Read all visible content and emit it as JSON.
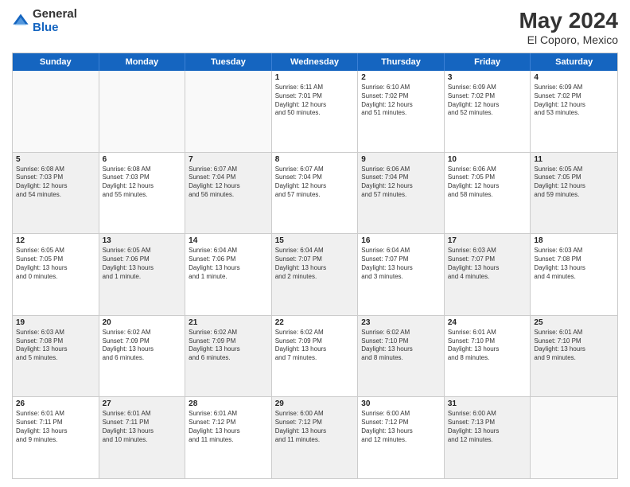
{
  "header": {
    "logo_general": "General",
    "logo_blue": "Blue",
    "title": "May 2024",
    "subtitle": "El Coporo, Mexico"
  },
  "weekdays": [
    "Sunday",
    "Monday",
    "Tuesday",
    "Wednesday",
    "Thursday",
    "Friday",
    "Saturday"
  ],
  "rows": [
    {
      "shade": [
        false,
        false,
        false,
        false,
        false,
        false,
        false
      ],
      "cells": [
        {
          "day": "",
          "lines": []
        },
        {
          "day": "",
          "lines": []
        },
        {
          "day": "",
          "lines": []
        },
        {
          "day": "1",
          "lines": [
            "Sunrise: 6:11 AM",
            "Sunset: 7:01 PM",
            "Daylight: 12 hours",
            "and 50 minutes."
          ]
        },
        {
          "day": "2",
          "lines": [
            "Sunrise: 6:10 AM",
            "Sunset: 7:02 PM",
            "Daylight: 12 hours",
            "and 51 minutes."
          ]
        },
        {
          "day": "3",
          "lines": [
            "Sunrise: 6:09 AM",
            "Sunset: 7:02 PM",
            "Daylight: 12 hours",
            "and 52 minutes."
          ]
        },
        {
          "day": "4",
          "lines": [
            "Sunrise: 6:09 AM",
            "Sunset: 7:02 PM",
            "Daylight: 12 hours",
            "and 53 minutes."
          ]
        }
      ]
    },
    {
      "shade": [
        true,
        false,
        true,
        false,
        true,
        false,
        true
      ],
      "cells": [
        {
          "day": "5",
          "lines": [
            "Sunrise: 6:08 AM",
            "Sunset: 7:03 PM",
            "Daylight: 12 hours",
            "and 54 minutes."
          ]
        },
        {
          "day": "6",
          "lines": [
            "Sunrise: 6:08 AM",
            "Sunset: 7:03 PM",
            "Daylight: 12 hours",
            "and 55 minutes."
          ]
        },
        {
          "day": "7",
          "lines": [
            "Sunrise: 6:07 AM",
            "Sunset: 7:04 PM",
            "Daylight: 12 hours",
            "and 56 minutes."
          ]
        },
        {
          "day": "8",
          "lines": [
            "Sunrise: 6:07 AM",
            "Sunset: 7:04 PM",
            "Daylight: 12 hours",
            "and 57 minutes."
          ]
        },
        {
          "day": "9",
          "lines": [
            "Sunrise: 6:06 AM",
            "Sunset: 7:04 PM",
            "Daylight: 12 hours",
            "and 57 minutes."
          ]
        },
        {
          "day": "10",
          "lines": [
            "Sunrise: 6:06 AM",
            "Sunset: 7:05 PM",
            "Daylight: 12 hours",
            "and 58 minutes."
          ]
        },
        {
          "day": "11",
          "lines": [
            "Sunrise: 6:05 AM",
            "Sunset: 7:05 PM",
            "Daylight: 12 hours",
            "and 59 minutes."
          ]
        }
      ]
    },
    {
      "shade": [
        false,
        true,
        false,
        true,
        false,
        true,
        false
      ],
      "cells": [
        {
          "day": "12",
          "lines": [
            "Sunrise: 6:05 AM",
            "Sunset: 7:05 PM",
            "Daylight: 13 hours",
            "and 0 minutes."
          ]
        },
        {
          "day": "13",
          "lines": [
            "Sunrise: 6:05 AM",
            "Sunset: 7:06 PM",
            "Daylight: 13 hours",
            "and 1 minute."
          ]
        },
        {
          "day": "14",
          "lines": [
            "Sunrise: 6:04 AM",
            "Sunset: 7:06 PM",
            "Daylight: 13 hours",
            "and 1 minute."
          ]
        },
        {
          "day": "15",
          "lines": [
            "Sunrise: 6:04 AM",
            "Sunset: 7:07 PM",
            "Daylight: 13 hours",
            "and 2 minutes."
          ]
        },
        {
          "day": "16",
          "lines": [
            "Sunrise: 6:04 AM",
            "Sunset: 7:07 PM",
            "Daylight: 13 hours",
            "and 3 minutes."
          ]
        },
        {
          "day": "17",
          "lines": [
            "Sunrise: 6:03 AM",
            "Sunset: 7:07 PM",
            "Daylight: 13 hours",
            "and 4 minutes."
          ]
        },
        {
          "day": "18",
          "lines": [
            "Sunrise: 6:03 AM",
            "Sunset: 7:08 PM",
            "Daylight: 13 hours",
            "and 4 minutes."
          ]
        }
      ]
    },
    {
      "shade": [
        true,
        false,
        true,
        false,
        true,
        false,
        true
      ],
      "cells": [
        {
          "day": "19",
          "lines": [
            "Sunrise: 6:03 AM",
            "Sunset: 7:08 PM",
            "Daylight: 13 hours",
            "and 5 minutes."
          ]
        },
        {
          "day": "20",
          "lines": [
            "Sunrise: 6:02 AM",
            "Sunset: 7:09 PM",
            "Daylight: 13 hours",
            "and 6 minutes."
          ]
        },
        {
          "day": "21",
          "lines": [
            "Sunrise: 6:02 AM",
            "Sunset: 7:09 PM",
            "Daylight: 13 hours",
            "and 6 minutes."
          ]
        },
        {
          "day": "22",
          "lines": [
            "Sunrise: 6:02 AM",
            "Sunset: 7:09 PM",
            "Daylight: 13 hours",
            "and 7 minutes."
          ]
        },
        {
          "day": "23",
          "lines": [
            "Sunrise: 6:02 AM",
            "Sunset: 7:10 PM",
            "Daylight: 13 hours",
            "and 8 minutes."
          ]
        },
        {
          "day": "24",
          "lines": [
            "Sunrise: 6:01 AM",
            "Sunset: 7:10 PM",
            "Daylight: 13 hours",
            "and 8 minutes."
          ]
        },
        {
          "day": "25",
          "lines": [
            "Sunrise: 6:01 AM",
            "Sunset: 7:10 PM",
            "Daylight: 13 hours",
            "and 9 minutes."
          ]
        }
      ]
    },
    {
      "shade": [
        false,
        true,
        false,
        true,
        false,
        true,
        false
      ],
      "cells": [
        {
          "day": "26",
          "lines": [
            "Sunrise: 6:01 AM",
            "Sunset: 7:11 PM",
            "Daylight: 13 hours",
            "and 9 minutes."
          ]
        },
        {
          "day": "27",
          "lines": [
            "Sunrise: 6:01 AM",
            "Sunset: 7:11 PM",
            "Daylight: 13 hours",
            "and 10 minutes."
          ]
        },
        {
          "day": "28",
          "lines": [
            "Sunrise: 6:01 AM",
            "Sunset: 7:12 PM",
            "Daylight: 13 hours",
            "and 11 minutes."
          ]
        },
        {
          "day": "29",
          "lines": [
            "Sunrise: 6:00 AM",
            "Sunset: 7:12 PM",
            "Daylight: 13 hours",
            "and 11 minutes."
          ]
        },
        {
          "day": "30",
          "lines": [
            "Sunrise: 6:00 AM",
            "Sunset: 7:12 PM",
            "Daylight: 13 hours",
            "and 12 minutes."
          ]
        },
        {
          "day": "31",
          "lines": [
            "Sunrise: 6:00 AM",
            "Sunset: 7:13 PM",
            "Daylight: 13 hours",
            "and 12 minutes."
          ]
        },
        {
          "day": "",
          "lines": []
        }
      ]
    }
  ]
}
